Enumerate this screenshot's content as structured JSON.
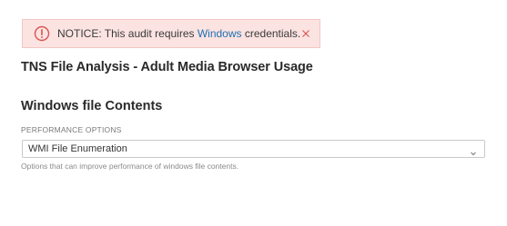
{
  "notice": {
    "prefix": "NOTICE: This audit requires ",
    "link": "Windows",
    "suffix": " credentials.",
    "icon": "alert-circle-icon",
    "close_icon": "close-icon",
    "color": "#fbe3e1",
    "icon_color": "#d9534f"
  },
  "page": {
    "title": "TNS File Analysis - Adult Media Browser Usage"
  },
  "section": {
    "title": "Windows file Contents"
  },
  "performance_options": {
    "label": "PERFORMANCE OPTIONS",
    "selected": "WMI File Enumeration",
    "help": "Options that can improve performance of windows file contents.",
    "chevron_icon": "chevron-down-icon"
  }
}
